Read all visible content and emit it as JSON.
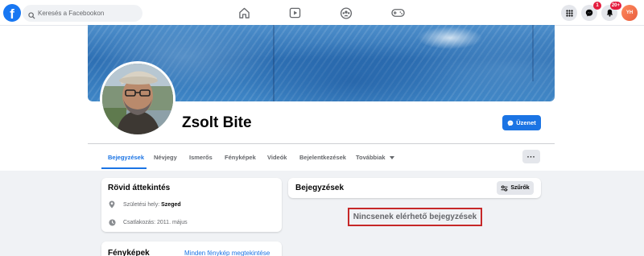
{
  "topbar": {
    "logo": "f",
    "search_placeholder": "Keresés a Facebookon",
    "nav_icons": [
      "home-icon",
      "video-icon",
      "groups-icon",
      "gaming-icon"
    ],
    "messenger_badge": "1",
    "notifications_badge": "20+",
    "avatar_initials": "YH",
    "colors": {
      "brand": "#1877f2",
      "badge": "#e41e3f"
    }
  },
  "profile": {
    "name": "Zsolt Bite",
    "message_button": "Üzenet"
  },
  "tabs": [
    {
      "label": "Bejegyzések",
      "active": true
    },
    {
      "label": "Névjegy"
    },
    {
      "label": "Ismerős"
    },
    {
      "label": "Fényképek"
    },
    {
      "label": "Videók"
    },
    {
      "label": "Bejelentkezések"
    },
    {
      "label": "Továbbiak"
    }
  ],
  "more_menu_label": "···",
  "intro": {
    "title": "Rövid áttekintés",
    "birthplace_label": "Születési hely:",
    "birthplace_value": "Szeged",
    "joined": "Csatlakozás: 2011. május"
  },
  "photos": {
    "title": "Fényképek",
    "all_link": "Minden fénykép megtekintése"
  },
  "posts": {
    "title": "Bejegyzések",
    "filter_button": "Szűrők",
    "empty_text": "Nincsenek elérhető bejegyzések",
    "highlight_color": "#c62828"
  }
}
